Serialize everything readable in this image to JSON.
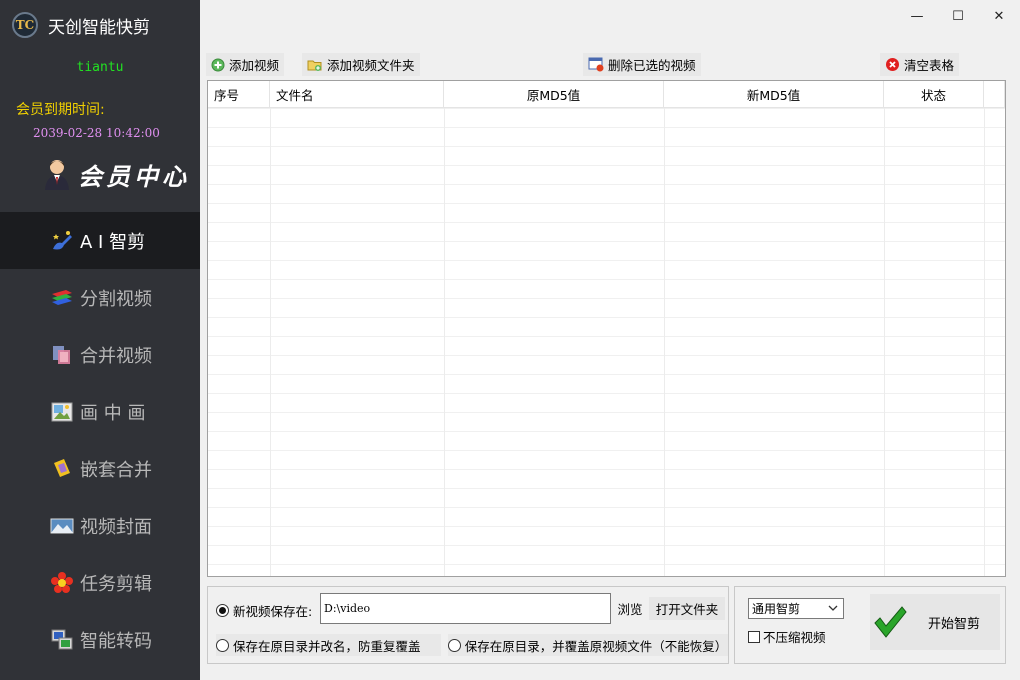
{
  "app": {
    "title": "天创智能快剪",
    "logo_text": "TC"
  },
  "user": {
    "name": "tiantu",
    "expire_label": "会员到期时间:",
    "expire_value": "2039-02-28 10:42:00"
  },
  "member_center": {
    "label": "会员中心"
  },
  "nav": [
    {
      "label": "A I 智剪",
      "icon": "ai-brush-icon",
      "active": true
    },
    {
      "label": "分割视频",
      "icon": "split-layers-icon",
      "active": false
    },
    {
      "label": "合并视频",
      "icon": "merge-frames-icon",
      "active": false
    },
    {
      "label": "画 中 画",
      "icon": "picture-in-picture-icon",
      "active": false
    },
    {
      "label": "嵌套合并",
      "icon": "nested-merge-icon",
      "active": false
    },
    {
      "label": "视频封面",
      "icon": "cover-image-icon",
      "active": false
    },
    {
      "label": "任务剪辑",
      "icon": "flower-icon",
      "active": false
    },
    {
      "label": "智能转码",
      "icon": "transcode-icon",
      "active": false
    }
  ],
  "window": {
    "minimize": "—",
    "maximize": "☐",
    "close": "✕"
  },
  "toolbar": {
    "add_video": "添加视频",
    "add_folder": "添加视频文件夹",
    "delete_selected": "删除已选的视频",
    "clear_table": "清空表格"
  },
  "table": {
    "columns": [
      "序号",
      "文件名",
      "原MD5值",
      "新MD5值",
      "状态",
      ""
    ],
    "rows": []
  },
  "save": {
    "option_new_label": "新视频保存在:",
    "path_value": "D:\\video",
    "browse": "浏览",
    "open_folder": "打开文件夹",
    "option_rename": "保存在原目录并改名，防重复覆盖",
    "option_overwrite": "保存在原目录，并覆盖原视频文件（不能恢复）"
  },
  "process": {
    "mode_selected": "通用智剪",
    "no_compress_label": "不压缩视频",
    "start_label": "开始智剪"
  },
  "colors": {
    "sidebar_bg": "#303237",
    "active_bg": "#1b1c1f",
    "username": "#22e222",
    "expire_label": "#f0d000",
    "expire_value": "#e090f0"
  }
}
